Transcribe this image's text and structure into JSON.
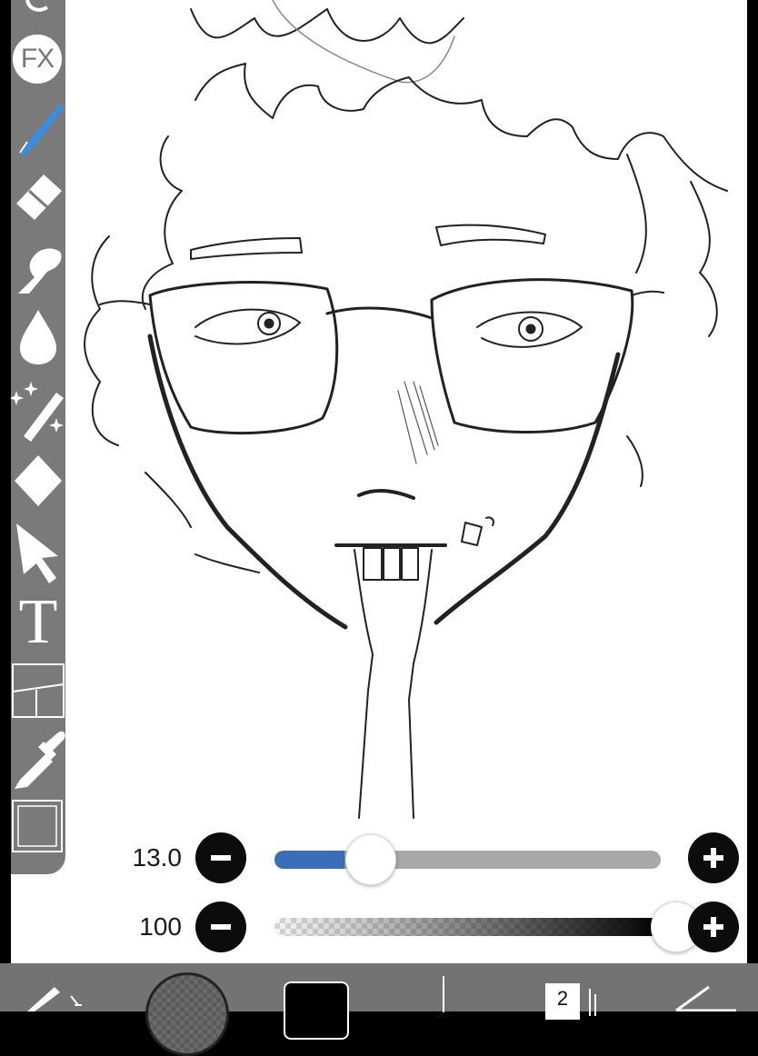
{
  "toolbar": {
    "fx_label": "FX",
    "tools": [
      {
        "name": "brush",
        "icon": "brush-icon",
        "active": true
      },
      {
        "name": "eraser",
        "icon": "eraser-icon"
      },
      {
        "name": "smudge",
        "icon": "finger-smudge-icon"
      },
      {
        "name": "blur",
        "icon": "drop-icon"
      },
      {
        "name": "magic-wand",
        "icon": "magic-wand-icon"
      },
      {
        "name": "fill",
        "icon": "fill-diamond-icon"
      },
      {
        "name": "move",
        "icon": "arrow-pointer-icon"
      },
      {
        "name": "text",
        "icon": "text-icon",
        "glyph": "T"
      },
      {
        "name": "frame-divider",
        "icon": "frame-divider-icon"
      },
      {
        "name": "eyedropper",
        "icon": "eyedropper-icon"
      },
      {
        "name": "canvas",
        "icon": "canvas-frame-icon"
      }
    ],
    "active_color": "#3a8ee0"
  },
  "brush_size": {
    "value_label": "13.0",
    "value": 13.0,
    "fill_fraction": 0.18,
    "minus_icon": "minus-icon",
    "plus_icon": "plus-icon"
  },
  "brush_opacity": {
    "value_label": "100",
    "value": 100,
    "fill_fraction": 1.0,
    "minus_icon": "minus-icon",
    "plus_icon": "plus-icon"
  },
  "bottom_bar": {
    "layer_count": "2",
    "items": [
      "brush-settings-icon",
      "brush-preview",
      "color-swatch",
      "vertical-tool-icon",
      "layers-button",
      "undo-icon"
    ],
    "color_swatch": "#000000"
  },
  "colors": {
    "toolbar_bg": "#7a7a7a",
    "bottom_bar_bg": "#737373",
    "slider_fill": "#3a6fb8"
  }
}
